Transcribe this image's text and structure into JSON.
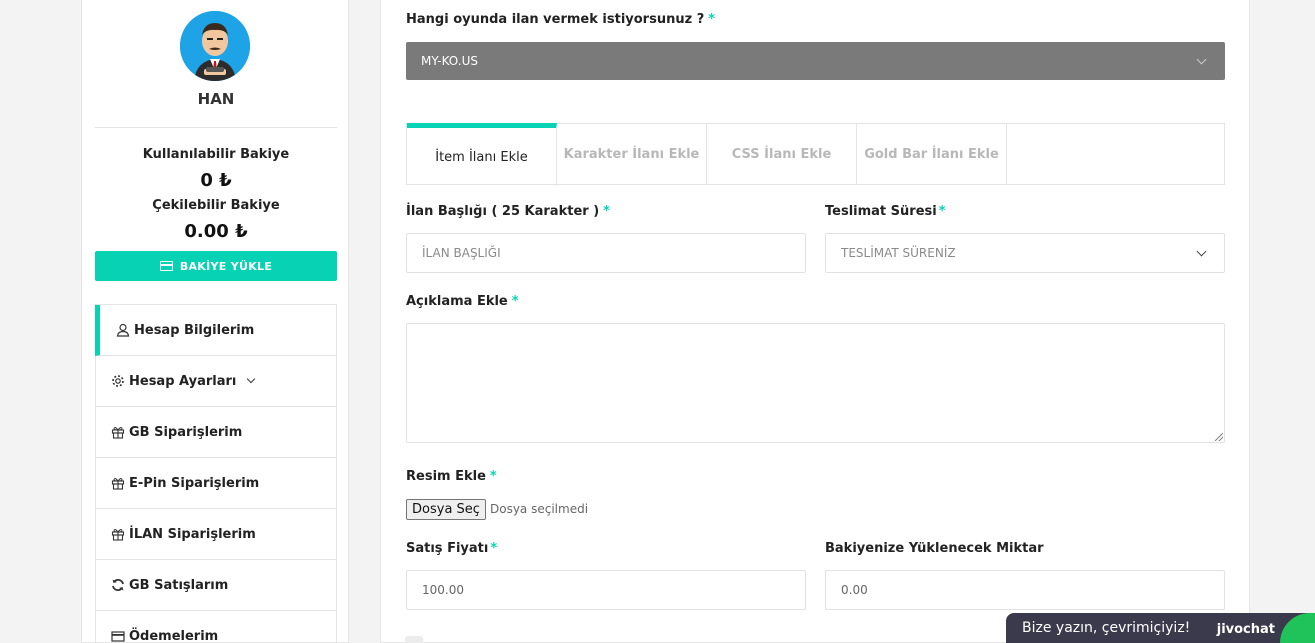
{
  "user": {
    "name": "HAN",
    "usable_balance_label": "Kullanılabilir Bakiye",
    "usable_balance": "0 ₺",
    "withdrawable_balance_label": "Çekilebilir Bakiye",
    "withdrawable_balance": "0.00 ₺",
    "load_button": "BAKİYE YÜKLE"
  },
  "menu": [
    {
      "label": "Hesap Bilgilerim",
      "icon": "user-icon",
      "active": true
    },
    {
      "label": "Hesap Ayarları",
      "icon": "gear-icon"
    },
    {
      "label": "GB Siparişlerim",
      "icon": "gift-icon"
    },
    {
      "label": "E-Pin Siparişlerim",
      "icon": "gift-icon"
    },
    {
      "label": "İLAN Siparişlerim",
      "icon": "gift-icon"
    },
    {
      "label": "GB Satışlarım",
      "icon": "refresh-icon"
    },
    {
      "label": "Ödemelerim",
      "icon": "card-icon"
    }
  ],
  "form": {
    "game_question": "Hangi oyunda ilan vermek istiyorsunuz ?",
    "game_value": "MY-KO.US",
    "tabs": [
      "İtem İlanı Ekle",
      "Karakter İlanı Ekle",
      "CSS İlanı Ekle",
      "Gold Bar İlanı Ekle"
    ],
    "title_label": "İlan Başlığı ( 25 Karakter )",
    "title_placeholder": "İLAN BAŞLIĞI",
    "delivery_label": "Teslimat Süresi",
    "delivery_placeholder": "TESLİMAT SÜRENİZ",
    "description_label": "Açıklama Ekle",
    "image_label": "Resim Ekle",
    "file_button": "Dosya Seç",
    "file_status": "Dosya seçilmedi",
    "price_label": "Satış Fiyatı",
    "price_value": "100.00",
    "payout_label": "Bakiyenize Yüklenecek Miktar",
    "payout_value": "0.00",
    "required_mark": "*"
  },
  "chat": {
    "text": "Bize yazın, çevrimiçiyiz!",
    "brand": "jivochat"
  },
  "colors": {
    "accent": "#08d2b4",
    "select_bg": "#7a7a7a",
    "chat_bg": "#3b3a4c",
    "avatar_bg": "#1ea4e6"
  }
}
